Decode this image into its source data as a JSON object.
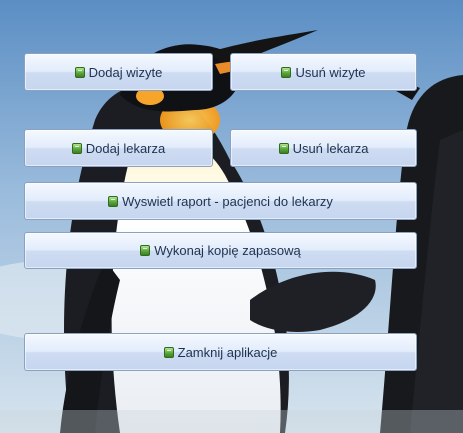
{
  "buttons": {
    "add_visit": "Dodaj wizyte",
    "delete_visit": "Usuń wizyte",
    "add_doctor": "Dodaj lekarza",
    "delete_doctor": "Usuń lekarza",
    "report": "Wyswietl raport - pacjenci do lekarzy",
    "backup": "Wykonaj kopię zapasową",
    "close": "Zamknij aplikacje"
  },
  "icons": {
    "button_icon": "green-document-icon"
  },
  "colors": {
    "sky_top": "#5b8ec4",
    "sky_bottom": "#d7e4ee",
    "button_border": "#8aa1c2",
    "button_text": "#1e3350"
  }
}
